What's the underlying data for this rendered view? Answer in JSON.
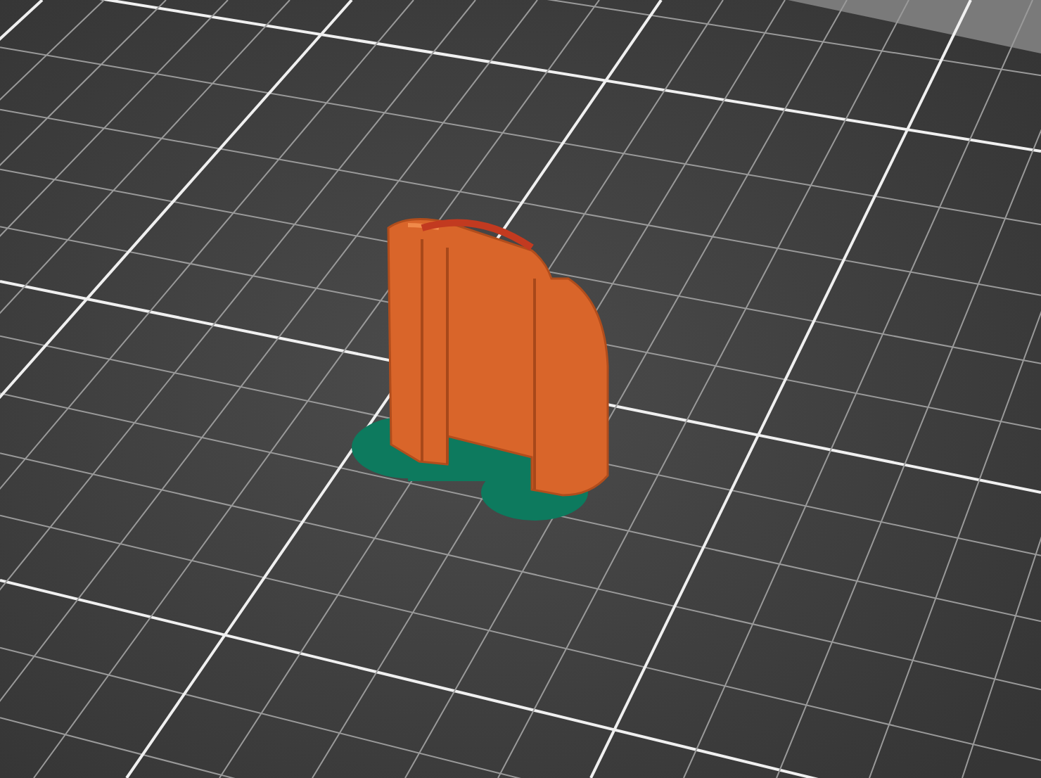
{
  "scene": {
    "kind": "layer-preview"
  }
}
